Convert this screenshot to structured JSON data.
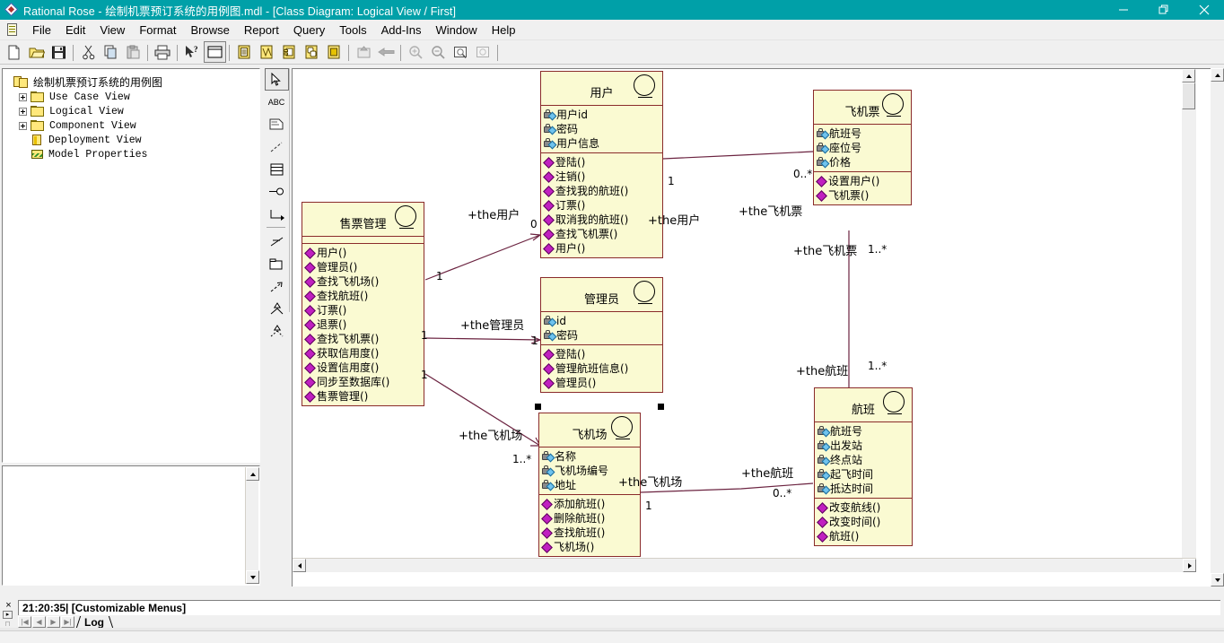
{
  "window": {
    "title": "Rational Rose - 绘制机票预订系统的用例图.mdl - [Class Diagram: Logical View / First]",
    "app_icon": "rational-rose-icon",
    "minimize": "—",
    "maximize": "❐",
    "close": "✕",
    "mdi_minimize": "_",
    "mdi_restore": "❐",
    "mdi_close": "✕"
  },
  "menu": {
    "items": [
      {
        "label": "File"
      },
      {
        "label": "Edit"
      },
      {
        "label": "View"
      },
      {
        "label": "Format"
      },
      {
        "label": "Browse"
      },
      {
        "label": "Report"
      },
      {
        "label": "Query"
      },
      {
        "label": "Tools"
      },
      {
        "label": "Add-Ins"
      },
      {
        "label": "Window"
      },
      {
        "label": "Help"
      }
    ]
  },
  "toolbar": {
    "buttons": [
      {
        "name": "new-icon",
        "title": "New"
      },
      {
        "name": "open-icon",
        "title": "Open"
      },
      {
        "name": "save-icon",
        "title": "Save"
      },
      {
        "name": "cut-icon",
        "title": "Cut"
      },
      {
        "name": "copy-icon",
        "title": "Copy"
      },
      {
        "name": "paste-icon",
        "title": "Paste"
      },
      {
        "name": "print-icon",
        "title": "Print"
      },
      {
        "name": "context-help-icon",
        "title": "Context Help"
      },
      {
        "name": "browse-class-diagram-icon",
        "title": "Browse Class Diagram"
      },
      {
        "name": "browse-use-case-diagram-icon",
        "title": "Browse Use Case Diagram"
      },
      {
        "name": "browse-interaction-diagram-icon",
        "title": "Browse Interaction Diagram"
      },
      {
        "name": "browse-component-diagram-icon",
        "title": "Browse Component Diagram"
      },
      {
        "name": "browse-state-machine-diagram-icon",
        "title": "Browse State Machine Diagram"
      },
      {
        "name": "browse-deployment-diagram-icon",
        "title": "Browse Deployment Diagram"
      },
      {
        "name": "browse-parent-icon",
        "title": "Browse Parent"
      },
      {
        "name": "browse-previous-diagram-icon",
        "title": "Browse Previous Diagram"
      },
      {
        "name": "zoom-in-icon",
        "title": "Zoom In"
      },
      {
        "name": "zoom-out-icon",
        "title": "Zoom Out"
      },
      {
        "name": "fit-in-window-icon",
        "title": "Fit In Window"
      },
      {
        "name": "undo-fit-icon",
        "title": "Undo Fit In Window"
      }
    ]
  },
  "browser": {
    "root": "绘制机票预订系统的用例图",
    "items": [
      {
        "label": "Use Case View",
        "icon": "folder-icon",
        "expandable": true
      },
      {
        "label": "Logical View",
        "icon": "folder-icon",
        "expandable": true
      },
      {
        "label": "Component View",
        "icon": "folder-icon",
        "expandable": true
      },
      {
        "label": "Deployment View",
        "icon": "deployment-node-icon",
        "expandable": false
      },
      {
        "label": "Model Properties",
        "icon": "model-properties-icon",
        "expandable": false
      }
    ]
  },
  "documentation": {
    "text": ""
  },
  "toolbox": {
    "tools": [
      {
        "name": "selection-tool",
        "label": "Selection Tool",
        "selected": true
      },
      {
        "name": "text-box-tool",
        "label": "ABC",
        "selected": false
      },
      {
        "name": "note-tool",
        "label": "Note",
        "selected": false
      },
      {
        "name": "anchor-note-tool",
        "label": "Anchor Note To Item",
        "selected": false
      },
      {
        "name": "class-tool",
        "label": "Class",
        "selected": false
      },
      {
        "name": "interface-tool",
        "label": "Interface",
        "selected": false
      },
      {
        "name": "unidirectional-association-tool",
        "label": "Unidirectional Association",
        "selected": false
      },
      {
        "name": "association-class-tool",
        "label": "Association Class",
        "selected": false
      },
      {
        "name": "package-tool",
        "label": "Package",
        "selected": false
      },
      {
        "name": "dependency-tool",
        "label": "Dependency or Instantiates",
        "selected": false
      },
      {
        "name": "generalization-tool",
        "label": "Generalization",
        "selected": false
      },
      {
        "name": "realize-tool",
        "label": "Realize",
        "selected": false
      }
    ]
  },
  "diagram": {
    "classes": [
      {
        "name": "售票管理",
        "attributes": [],
        "operations": [
          "用户()",
          "管理员()",
          "查找飞机场()",
          "查找航班()",
          "订票()",
          "退票()",
          "查找飞机票()",
          "获取信用度()",
          "设置信用度()",
          "同步至数据库()",
          "售票管理()"
        ]
      },
      {
        "name": "用户",
        "attributes": [
          "用户id",
          "密码",
          "用户信息"
        ],
        "operations": [
          "登陆()",
          "注销()",
          "查找我的航班()",
          "订票()",
          "取消我的航班()",
          "查找飞机票()",
          "用户()"
        ]
      },
      {
        "name": "飞机票",
        "attributes": [
          "航班号",
          "座位号",
          "价格"
        ],
        "operations": [
          "设置用户()",
          "飞机票()"
        ]
      },
      {
        "name": "管理员",
        "attributes": [
          "id",
          "密码"
        ],
        "operations": [
          "登陆()",
          "管理航班信息()",
          "管理员()"
        ]
      },
      {
        "name": "飞机场",
        "attributes": [
          "名称",
          "飞机场编号",
          "地址"
        ],
        "operations": [
          "添加航班()",
          "删除航班()",
          "查找航班()",
          "飞机场()"
        ]
      },
      {
        "name": "航班",
        "attributes": [
          "航班号",
          "出发站",
          "终点站",
          "起飞时间",
          "抵达时间"
        ],
        "operations": [
          "改变航线()",
          "改变时间()",
          "航班()"
        ]
      }
    ],
    "associations": [
      {
        "label": "+the用户",
        "source_mult": "1",
        "target_mult": "0"
      },
      {
        "label": "+the飞机票",
        "source_mult": "1",
        "target_mult": "0..*"
      },
      {
        "label": "+the管理员",
        "source_mult": "1",
        "target_mult": "1"
      },
      {
        "label": "+the飞机票",
        "source_mult": "1..*",
        "target_mult": "1..*"
      },
      {
        "label": "+the航班",
        "source_mult": "1..*",
        "target_mult": "1..*"
      },
      {
        "label": "+the飞机场",
        "source_mult": "1",
        "target_mult": "1..*"
      },
      {
        "label": "+the航班",
        "source_mult": "1",
        "target_mult": "0..*"
      }
    ],
    "edge_labels": {
      "user_left": "+the用户",
      "user_right": "+the用户",
      "ticket_top": "+the飞机票",
      "admin": "+the管理员",
      "ticket_vert": "+the飞机票",
      "flight_vert": "+the航班",
      "airport_left": "+the飞机场",
      "airport_right": "+the飞机场",
      "flight_right": "+the航班"
    },
    "multiplicities": {
      "m_user_left": "1",
      "m_user_zero": "0",
      "m_user_right": "1",
      "m_ticket_top": "0..*",
      "m_admin_left": "1",
      "m_admin_right": "1",
      "m_ticket_vert": "1..*",
      "m_flight_vert": "1..*",
      "m_airport_left": "1",
      "m_airport_star": "1..*",
      "m_airport_right": "1",
      "m_flight_right": "0..*"
    },
    "colors": {
      "class_fill": "#fafad2",
      "class_border": "#8a2b2b",
      "association_line": "#6b2340",
      "attribute_icon": "#6fc3ee",
      "operation_icon": "#c020c0"
    }
  },
  "log": {
    "message": "21:20:35|  [Customizable Menus]",
    "tab": "Log",
    "close_label": "×",
    "nav_first": "|◀",
    "nav_prev": "◀",
    "nav_next": "▶",
    "nav_last": "▶|"
  }
}
